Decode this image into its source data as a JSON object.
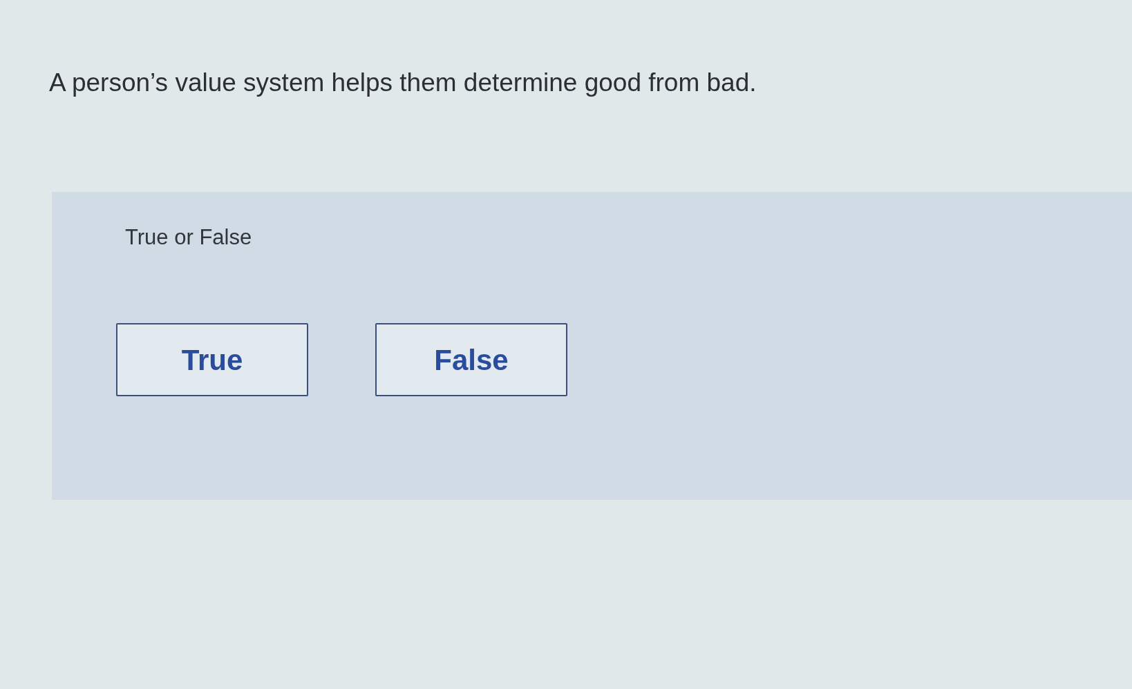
{
  "question": {
    "text": "A person’s value system helps them determine good from bad."
  },
  "answer_panel": {
    "prompt": "True or False",
    "options": [
      {
        "label": "True"
      },
      {
        "label": "False"
      }
    ]
  }
}
